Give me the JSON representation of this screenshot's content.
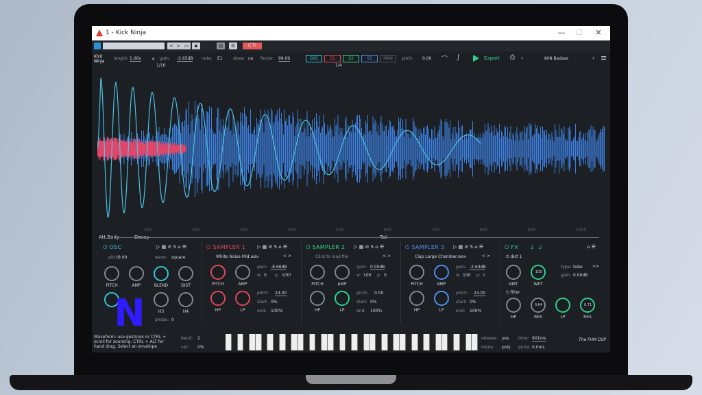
{
  "window": {
    "title": "1 - Kick Ninja"
  },
  "topbar": {
    "preset": "C T!"
  },
  "params": {
    "length_label": "length:",
    "length": "1.06s",
    "gain_label": "gain:",
    "gain": "-2.65dB",
    "note_label": "note:",
    "note": "E1",
    "skew_label": "skew:",
    "skew": "no",
    "factor_label": "factor:",
    "factor": "99.00",
    "grid": "1/16",
    "grid2": "1/4"
  },
  "source_tabs": [
    "OSC",
    "S1",
    "S2",
    "S3",
    "MAN"
  ],
  "pitch": {
    "label": "pitch:",
    "value": "0.00"
  },
  "export": {
    "label": "Export"
  },
  "preset": {
    "name": "808 Badass"
  },
  "wave_ticks": [
    "100",
    "200",
    "300",
    "400",
    "500",
    "600",
    "700",
    "800",
    "900",
    "1000"
  ],
  "segments": {
    "a": "Att.Body",
    "b": "Decay",
    "c": "Tail"
  },
  "osc": {
    "title": "OSC",
    "pitch_label": "pitch:",
    "pitch": "0.00",
    "wave_label": "wave:",
    "wave": "square",
    "knobs": [
      "PITCH",
      "AMP",
      "BLEND",
      "DIST"
    ],
    "knobs2": [
      "H3",
      "H4"
    ],
    "phase_label": "phase:",
    "phase": "0"
  },
  "s1": {
    "title": "SAMPLER 1",
    "file": "White Noise Mid.wav",
    "gain_label": "gain:",
    "gain": "-8.66dB",
    "w_label": "w:",
    "w": "0",
    "p_label": "p:",
    "p": "100!",
    "pitch_label": "pitch:",
    "pitch": "24.00",
    "start_label": "start:",
    "start": "0%",
    "end_label": "end:",
    "end": "100%",
    "knobs": [
      "PITCH",
      "AMP",
      "HP",
      "LP"
    ]
  },
  "s2": {
    "title": "SAMPLER 2",
    "file": "Click to load file",
    "gain_label": "gain:",
    "gain": "0.00dB",
    "w_label": "w:",
    "w": "100",
    "p_label": "p:",
    "p": "0",
    "pitch_label": "pitch:",
    "pitch": "0.00",
    "start_label": "start:",
    "start": "0%",
    "end_label": "end:",
    "end": "100%",
    "knobs": [
      "PITCH",
      "AMP",
      "HP",
      "LP"
    ]
  },
  "s3": {
    "title": "SAMPLER 3",
    "file": "Clap Large Chamber.wav",
    "gain_label": "gain:",
    "gain": "-2.64dB",
    "w_label": "w:",
    "w": "100",
    "p_label": "p:",
    "p": "c",
    "pitch_label": "pitch:",
    "pitch": "24.00",
    "start_label": "start:",
    "start": "0%",
    "end_label": "end:",
    "end": "100%",
    "knobs": [
      "PITCH",
      "AMP",
      "HP",
      "LP"
    ]
  },
  "fx": {
    "title": "FX",
    "tab1": "1",
    "tab2": "2",
    "dist_label": "dist 1",
    "type_label": "type:",
    "type": "tube",
    "gain_label": "gain:",
    "gain": "0.00dB",
    "amt": "AMT",
    "wet": "WET",
    "wet_value": "100",
    "filter_label": "filter",
    "knobs": [
      "HP",
      "RES",
      "LP",
      "RES"
    ],
    "res1": "0.64",
    "res2": "0.71"
  },
  "help": {
    "text": "Waveform: use gestures or CTRL + scroll for zooming. CTRL + ALT for hand drag. Select an envelope"
  },
  "bottom": {
    "bend_label": "bend:",
    "bend": "2",
    "vel_label": "vel:",
    "vel": "0%",
    "release_label": "release:",
    "release": "yes",
    "time_label": "time:",
    "time": "901ms",
    "mode_label": "mode:",
    "mode": "poly",
    "porta_label": "porta:",
    "porta": "0.0ms"
  },
  "brand": {
    "name": "The FHM DSP"
  },
  "colors": {
    "osc": "#37c6d6",
    "s1": "#e2485a",
    "s2": "#2fd38a",
    "s3": "#4d8ef0",
    "fx": "#2fd38a",
    "wave_blue": "#3d7fe0",
    "wave_cyan": "#4cc3e6",
    "wave_red": "#e0466a"
  }
}
